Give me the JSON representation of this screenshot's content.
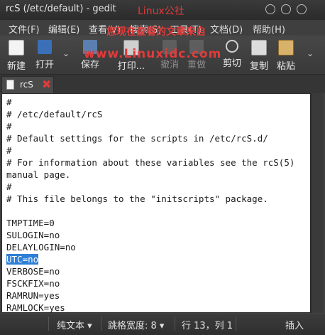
{
  "window": {
    "title": "rcS (/etc/default) - gedit"
  },
  "watermark": {
    "line1": "Linux公社",
    "line2": "您现在查看的文章来自",
    "line3": "www.Linuxidc.com"
  },
  "menubar": {
    "items": [
      "文件(F)",
      "编辑(E)",
      "查看(V)",
      "搜索(S)",
      "工具(T)",
      "文档(D)",
      "帮助(H)"
    ]
  },
  "toolbar": {
    "new": "新建",
    "open": "打开",
    "save": "保存",
    "print": "打印...",
    "undo": "撤消",
    "redo": "重做",
    "cut": "剪切",
    "copy": "复制",
    "paste": "粘贴"
  },
  "tabs": [
    {
      "label": "rcS"
    }
  ],
  "editor": {
    "lines": [
      "#",
      "# /etc/default/rcS",
      "#",
      "# Default settings for the scripts in /etc/rcS.d/",
      "#",
      "# For information about these variables see the rcS(5)",
      "manual page.",
      "#",
      "# This file belongs to the \"initscripts\" package.",
      "",
      "TMPTIME=0",
      "SULOGIN=no",
      "DELAYLOGIN=no",
      "UTC=no",
      "VERBOSE=no",
      "FSCKFIX=no",
      "RAMRUN=yes",
      "RAMLOCK=yes"
    ],
    "selected_line_index": 13
  },
  "statusbar": {
    "format": "纯文本 ▾",
    "tab_width": "跳格宽度: 8 ▾",
    "position": "行 13，列 1",
    "mode": "插入"
  }
}
